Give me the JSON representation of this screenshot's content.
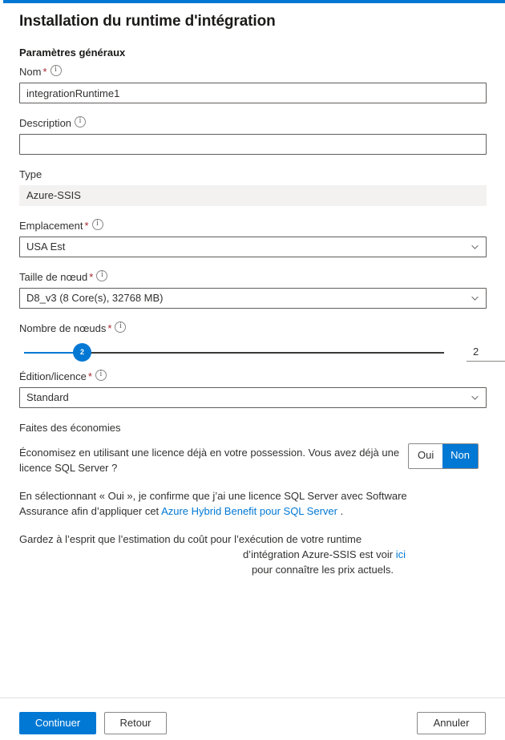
{
  "theme": {
    "accent": "#0078d4",
    "required_star": "#a4262c",
    "readonly_bg": "#f3f2f1",
    "border": "#605e5c",
    "text": "#323130",
    "link": "#0078d4"
  },
  "header": {
    "title": "Installation du runtime d'intégration"
  },
  "section": {
    "heading": "Paramètres généraux"
  },
  "fields": {
    "name": {
      "label": "Nom",
      "required_marker": "*",
      "value": "integrationRuntime1",
      "placeholder": ""
    },
    "description": {
      "label": "Description",
      "value": "",
      "placeholder": ""
    },
    "type": {
      "label": "Type",
      "value": "Azure-SSIS"
    },
    "location": {
      "label": "Emplacement",
      "required_marker": "*",
      "value": "USA Est"
    },
    "node_size": {
      "label": "Taille de nœud",
      "required_marker": "*",
      "value": "D8_v3 (8 Core(s), 32768 MB)"
    },
    "node_number": {
      "label": "Nombre de nœuds",
      "required_marker": "*",
      "value": "2",
      "thumb_label": "2"
    },
    "edition": {
      "label": "Édition/licence",
      "required_marker": "*",
      "value": "Standard"
    }
  },
  "savings": {
    "title": "Faites des économies",
    "question": "Économisez en utilisant une licence déjà en votre possession. Vous avez déjà une licence SQL Server ?",
    "toggle": {
      "yes_label": "Oui",
      "no_label": "Non",
      "selected": "Non"
    },
    "legal_prefix": "En sélectionnant « Oui », je confirme que j’ai une licence SQL Server avec Software Assurance afin d’appliquer cet ",
    "legal_link": "Azure Hybrid Benefit pour SQL Server",
    "legal_suffix": " .",
    "pricing_line1": "Gardez à l’esprit que l’estimation du coût pour l’exécution de votre runtime",
    "pricing_line2_prefix": "d’intégration Azure-SSIS est voir ",
    "pricing_link": "ici",
    "pricing_line3": "pour connaître les prix actuels."
  },
  "footer": {
    "continue_label": "Continuer",
    "back_label": "Retour",
    "cancel_label": "Annuler"
  }
}
